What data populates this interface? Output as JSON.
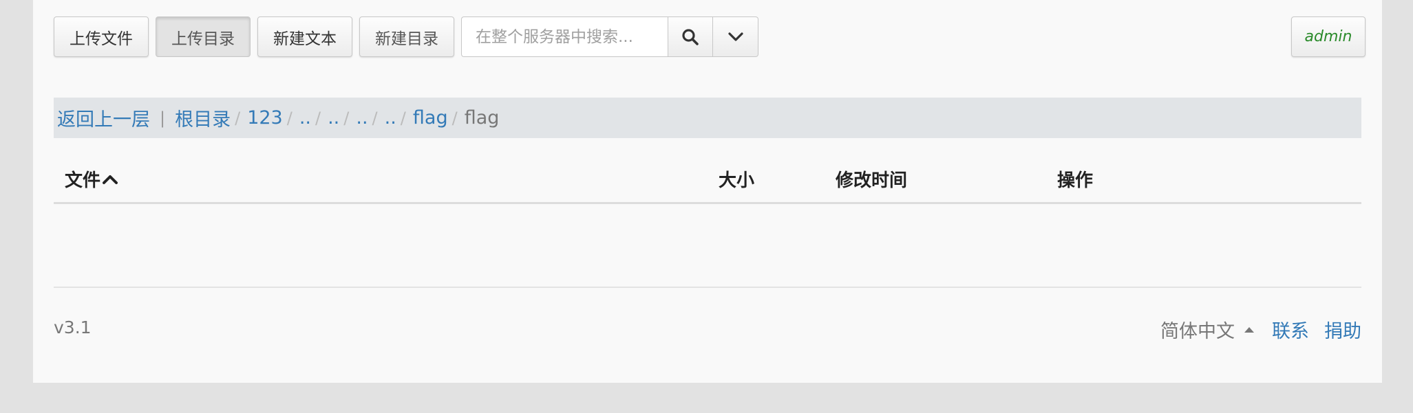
{
  "toolbar": {
    "upload_file_label": "上传文件",
    "upload_dir_label": "上传目录",
    "new_text_label": "新建文本",
    "new_dir_label": "新建目录",
    "search_placeholder": "在整个服务器中搜索...",
    "search_icon": "search-icon",
    "dropdown_icon": "chevron-down-icon",
    "user_label": "admin"
  },
  "breadcrumb": {
    "back_label": "返回上一层",
    "separator_bar": "|",
    "items": [
      "根目录",
      "123",
      "..",
      "..",
      "..",
      "..",
      "flag"
    ],
    "separator": "/",
    "current": "flag"
  },
  "table": {
    "columns": [
      "文件",
      "大小",
      "修改时间",
      "操作"
    ],
    "sort_indicator": "chevron-up-icon",
    "rows": []
  },
  "footer": {
    "version": "v3.1",
    "language": "简体中文",
    "contact_label": "联系",
    "donate_label": "捐助"
  },
  "colors": {
    "link": "#337ab7",
    "user": "#2a8a2a",
    "breadcrumb_bg": "#e1e4e7",
    "page_bg": "#f9f9f9",
    "outer_bg": "#e2e2e2"
  }
}
